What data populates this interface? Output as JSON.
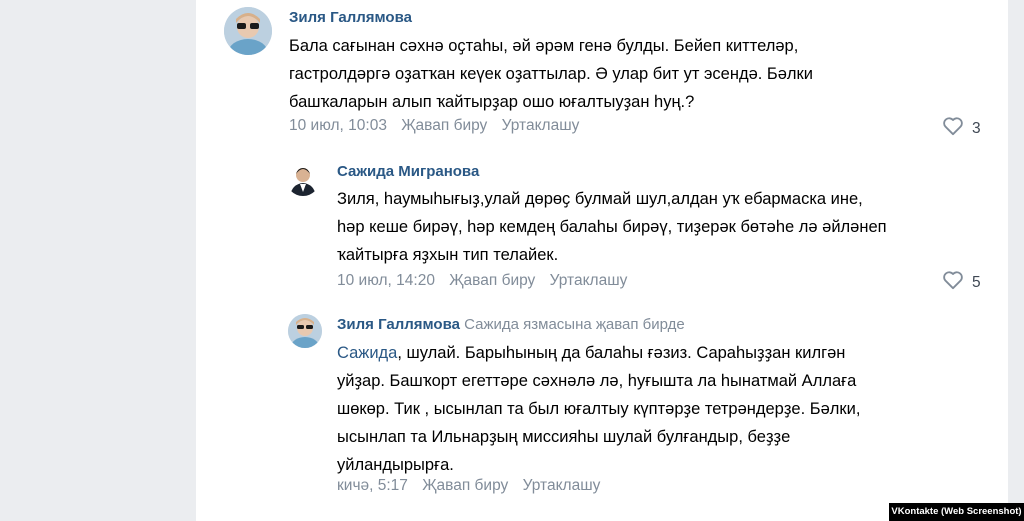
{
  "comments": [
    {
      "author": "Зиля Галлямова",
      "lines": [
        "Бала сағынан сәхнә оҫтаһы, әй әрәм генә булды. Бейеп киттеләр,",
        "гастролдәргә оҙатҡан кеүек оҙаттылар. Ә улар бит ут эсендә. Бәлки",
        "башҡаларын алып ҡайтырҙар ошо юғалтыуҙан һуң.?"
      ],
      "time": "10 июл, 10:03",
      "reply_label": "Җавап биру",
      "share_label": "Уртаклашу",
      "likes": "3"
    },
    {
      "author": "Сажида Мигранова",
      "lines": [
        "Зиля, һаумыһығыҙ,улай дөрөҫ булмай шул,алдан уҡ ебармаска ине,",
        "һәр кеше бирәү, һәр кемдең балаһы бирәү, тиҙерәк бөтәһе лә әйләнеп",
        "ҡайтырға яҙхын тип телайек."
      ],
      "time": "10 июл, 14:20",
      "reply_label": "Җавап биру",
      "share_label": "Уртаклашу",
      "likes": "5"
    },
    {
      "author": "Зиля Галлямова",
      "reply_to": "Сажида язмасына җавап бирде",
      "mention": "Сажида",
      "lines": [
        ", шулай. Барыһының да балаһы ғәзиз. Сараһыҙҙан килгән",
        "уйҙар. Башҡорт егеттәре сәхнәлә лә, һуғышта ла һынатмай Аллаға",
        "шөкөр. Тик , ысынлап та был юғалтыу күптәрҙе тетрәндерҙе. Бәлки,",
        "ысынлап та Ильнарҙың миссияһы шулай булғандыр, беҙҙе",
        "уйландырырға."
      ],
      "time": "кичә, 5:17",
      "reply_label": "Җавап биру",
      "share_label": "Уртаклашу"
    }
  ],
  "credit": "VKontakte (Web Screenshot)",
  "colors": {
    "author": "#2a5885",
    "meta": "#818c99",
    "gutter": "#ebedf0"
  }
}
